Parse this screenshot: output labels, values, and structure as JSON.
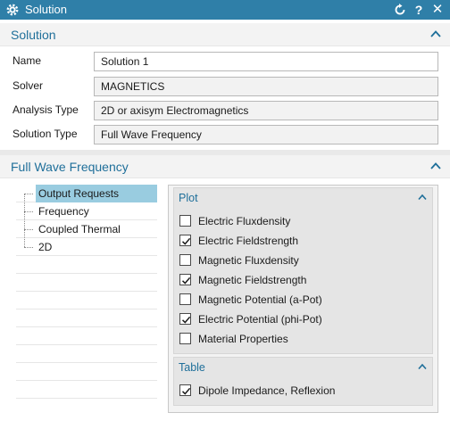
{
  "window": {
    "title": "Solution",
    "icons": [
      "gear-icon",
      "reset-icon",
      "help-icon",
      "close-icon"
    ],
    "help_glyph": "?",
    "close_glyph": "✕"
  },
  "solution_section": {
    "title": "Solution",
    "fields": [
      {
        "label": "Name",
        "value": "Solution 1",
        "editable": true
      },
      {
        "label": "Solver",
        "value": "MAGNETICS",
        "editable": false
      },
      {
        "label": "Analysis Type",
        "value": "2D or axisym Electromagnetics",
        "editable": false
      },
      {
        "label": "Solution Type",
        "value": "Full Wave Frequency",
        "editable": false
      }
    ]
  },
  "fwf_section": {
    "title": "Full Wave Frequency",
    "tree": [
      {
        "label": "Output Requests",
        "selected": true
      },
      {
        "label": "Frequency",
        "selected": false
      },
      {
        "label": "Coupled Thermal",
        "selected": false
      },
      {
        "label": "2D",
        "selected": false
      }
    ],
    "plot_group": {
      "title": "Plot",
      "items": [
        {
          "label": "Electric Fluxdensity",
          "checked": false
        },
        {
          "label": "Electric Fieldstrength",
          "checked": true
        },
        {
          "label": "Magnetic Fluxdensity",
          "checked": false
        },
        {
          "label": "Magnetic Fieldstrength",
          "checked": true
        },
        {
          "label": "Magnetic Potential (a-Pot)",
          "checked": false
        },
        {
          "label": "Electric Potential (phi-Pot)",
          "checked": true
        },
        {
          "label": "Material Properties",
          "checked": false
        }
      ]
    },
    "table_group": {
      "title": "Table",
      "items": [
        {
          "label": "Dipole Impedance, Reflexion",
          "checked": true
        }
      ]
    }
  },
  "colors": {
    "titlebar": "#2f7fa8",
    "accent": "#1f6f9a",
    "selection": "#99cce0"
  }
}
